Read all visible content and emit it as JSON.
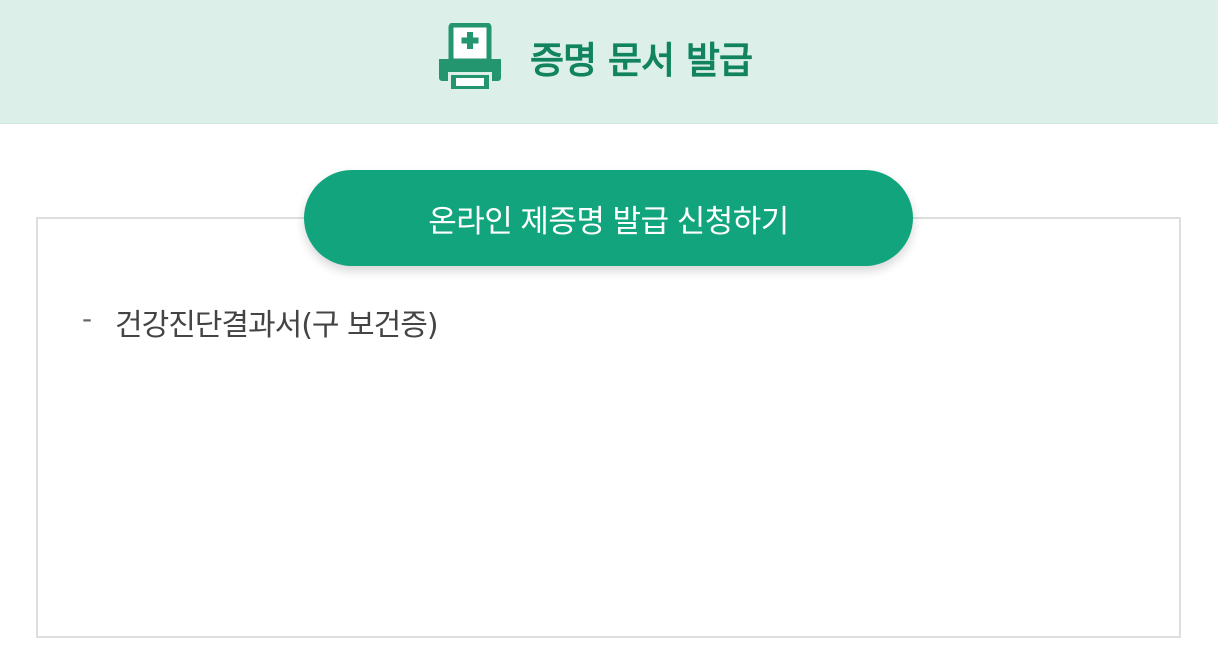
{
  "header": {
    "title": "증명 문서 발급",
    "icon": "printer-medical-icon",
    "background": "#dcf0e9",
    "title_color": "#11845f"
  },
  "main": {
    "apply_button_label": "온라인 제증명 발급 신청하기",
    "button_color": "#12a57d",
    "documents": [
      {
        "bullet": "-",
        "label": "건강진단결과서(구 보건증)"
      }
    ]
  }
}
